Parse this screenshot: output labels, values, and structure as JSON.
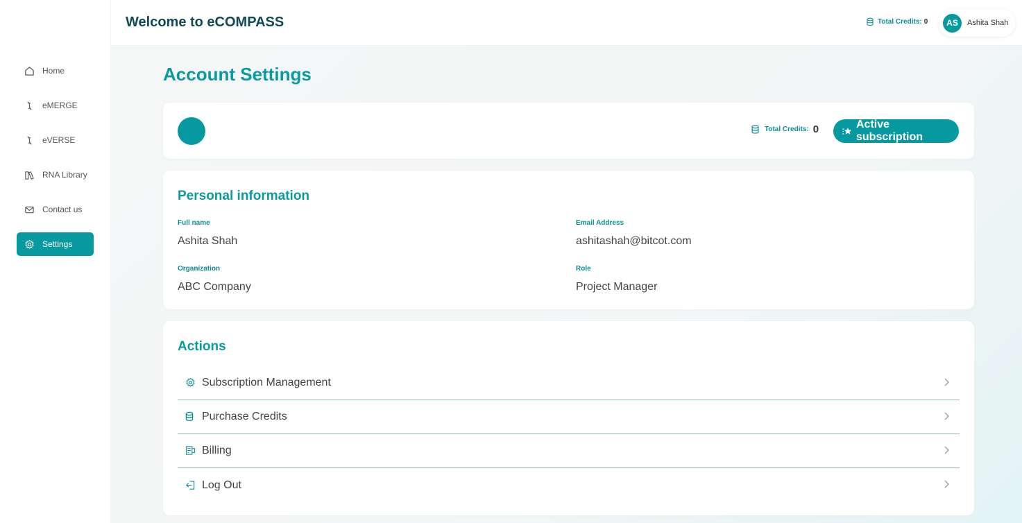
{
  "app": {
    "welcome": "Welcome to eCOMPASS",
    "top_credits_label": "Total Credits:",
    "top_credits_value": "0"
  },
  "user": {
    "initials": "AS",
    "name": "Ashita Shah"
  },
  "sidebar": {
    "items": [
      {
        "label": "Home",
        "icon": "home-icon"
      },
      {
        "label": "eMERGE",
        "icon": "dna-icon"
      },
      {
        "label": "eVERSE",
        "icon": "dna-icon"
      },
      {
        "label": "RNA Library",
        "icon": "library-icon"
      },
      {
        "label": "Contact us",
        "icon": "mail-icon"
      },
      {
        "label": "Settings",
        "icon": "gear-icon",
        "active": true
      }
    ]
  },
  "page": {
    "title": "Account Settings"
  },
  "summary": {
    "credits_label": "Total Credits:",
    "credits_value": "0",
    "subscription_button": "Active subscription"
  },
  "personal": {
    "title": "Personal information",
    "full_name_label": "Full name",
    "full_name": "Ashita Shah",
    "email_label": "Email Address",
    "email": "ashitashah@bitcot.com",
    "organization_label": "Organization",
    "organization": "ABC Company",
    "role_label": "Role",
    "role": "Project Manager"
  },
  "actions": {
    "title": "Actions",
    "items": [
      {
        "label": "Subscription Management",
        "icon": "gear-icon"
      },
      {
        "label": "Purchase Credits",
        "icon": "coins-icon"
      },
      {
        "label": "Billing",
        "icon": "billing-icon"
      },
      {
        "label": "Log Out",
        "icon": "logout-icon"
      }
    ]
  },
  "colors": {
    "accent": "#06999f",
    "title": "#0f4a55"
  }
}
